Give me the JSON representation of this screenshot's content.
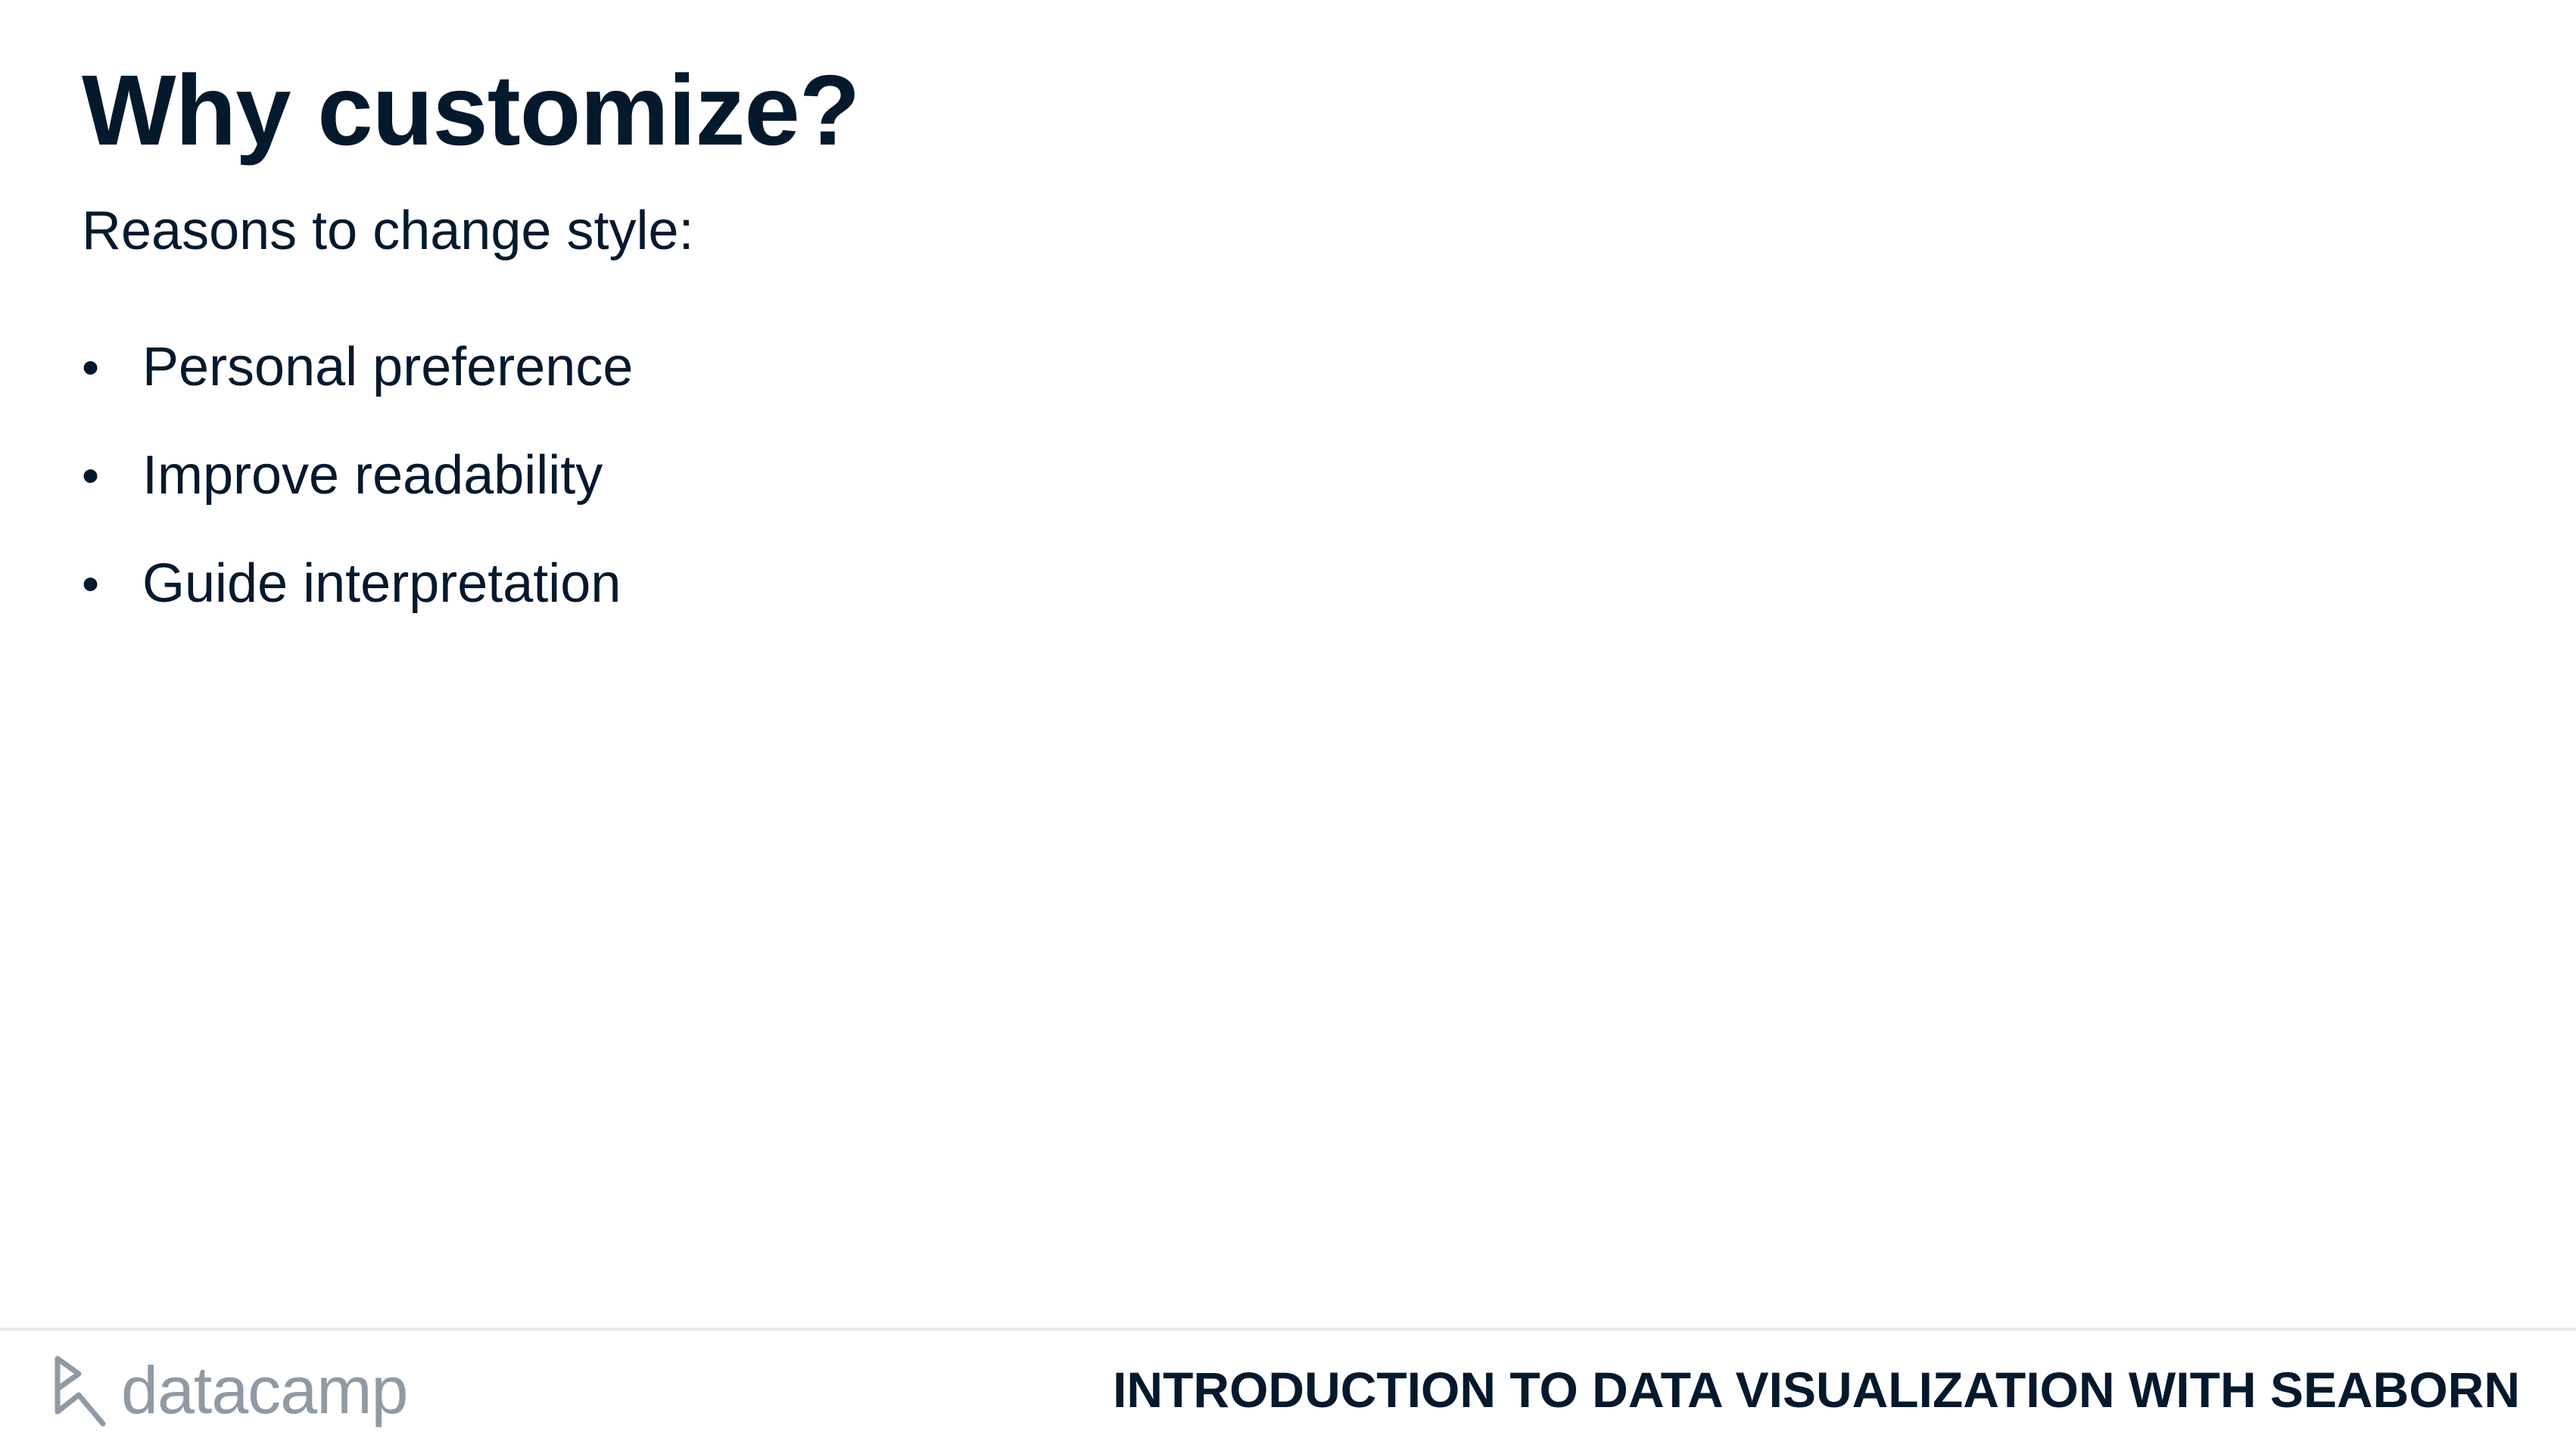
{
  "slide": {
    "title": "Why customize?",
    "subtitle": "Reasons to change style:",
    "bullets": [
      {
        "marker": "•",
        "text": "Personal preference"
      },
      {
        "marker": "•",
        "text": "Improve readability"
      },
      {
        "marker": "•",
        "text": "Guide interpretation"
      }
    ]
  },
  "footer": {
    "logo_text": "datacamp",
    "logo_icon": "datacamp-logo-icon",
    "course_title": "INTRODUCTION TO DATA VISUALIZATION WITH SEABORN"
  },
  "colors": {
    "text": "#05192d",
    "logo": "#8f9aa5",
    "divider": "#e5e7ea",
    "background": "#ffffff"
  }
}
